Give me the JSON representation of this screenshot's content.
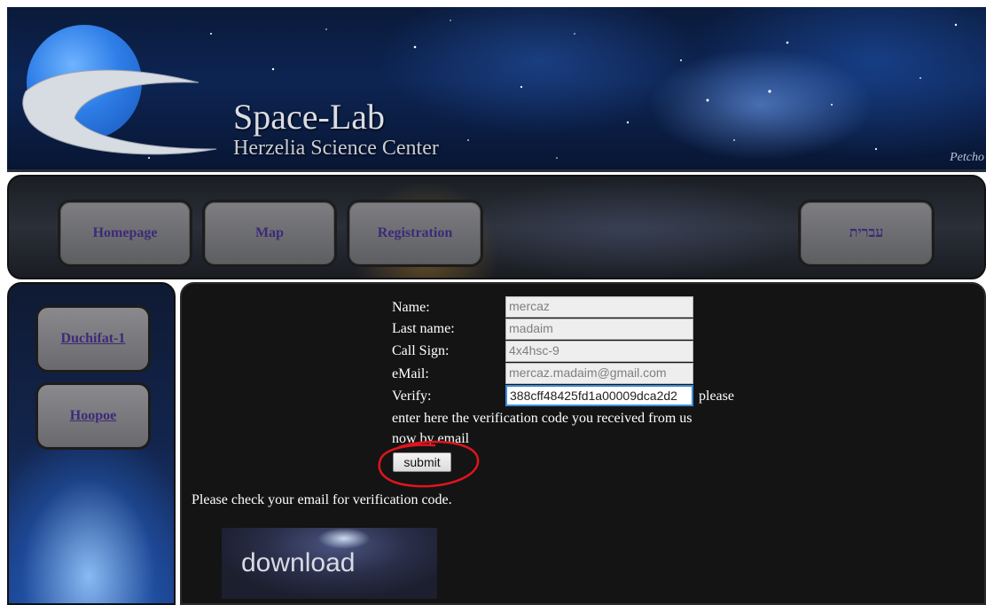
{
  "header": {
    "title": "Space-Lab",
    "subtitle": "Herzelia Science Center",
    "credit": "Petcho"
  },
  "nav": {
    "items": [
      "Homepage",
      "Map",
      "Registration"
    ],
    "language": "עברית"
  },
  "sidebar": {
    "items": [
      "Duchifat-1",
      "Hoopoe"
    ]
  },
  "form": {
    "name_label": "Name:",
    "name_value": "mercaz",
    "lastname_label": "Last name:",
    "lastname_value": "madaim",
    "callsign_label": "Call Sign:",
    "callsign_value": "4x4hsc-9",
    "email_label": "eMail:",
    "email_value": "mercaz.madaim@gmail.com",
    "verify_label": "Verify:",
    "verify_value": "388cff48425fd1a00009dca2d2",
    "verify_hint_1": "please",
    "verify_hint_2": "enter here the verification code you received from us",
    "verify_hint_3": "now by email",
    "submit_label": "submit"
  },
  "message": "Please check your email for verification code.",
  "download_label": "download",
  "colors": {
    "nav_text": "#3d2a78",
    "annotation": "#e0141e"
  }
}
